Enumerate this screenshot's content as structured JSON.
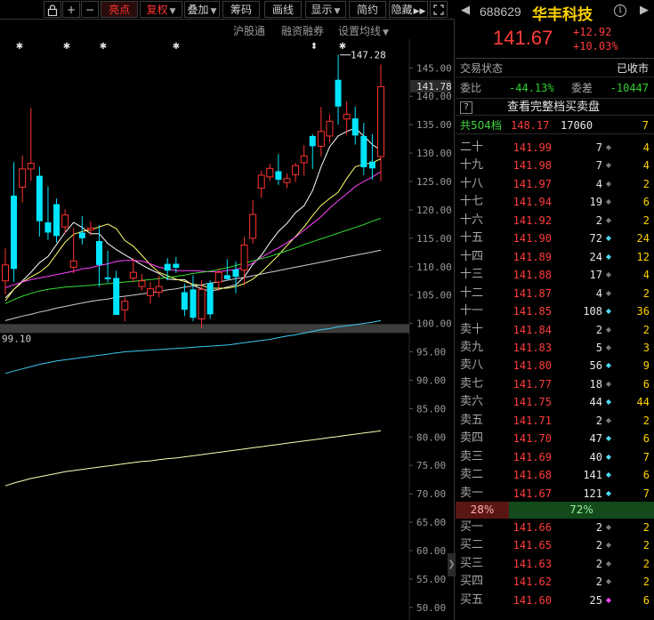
{
  "toolbar": {
    "buttons": [
      {
        "label": "",
        "icon": "lock-icon"
      },
      {
        "label": "+"
      },
      {
        "label": "−"
      },
      {
        "label": "亮点"
      },
      {
        "label": "复权"
      },
      {
        "label": "叠加"
      },
      {
        "label": "筹码"
      },
      {
        "label": "画线"
      },
      {
        "label": "显示"
      },
      {
        "label": "简约"
      },
      {
        "label": "隐藏"
      }
    ],
    "expand_icon": "expand-icon"
  },
  "subbar": {
    "hgt": "沪股通",
    "margin": "融资融券",
    "ma_settings": "设置均线"
  },
  "chart_data": {
    "type": "candlestick",
    "y_axis": {
      "ticks": [
        145.0,
        140.0,
        135.0,
        130.0,
        125.0,
        120.0,
        115.0,
        110.0,
        105.0,
        100.0,
        95.0,
        90.0,
        85.0,
        80.0,
        75.0,
        70.0,
        65.0,
        60.0,
        55.0,
        50.0
      ],
      "tick_labels": [
        "145.00",
        "140.00",
        "135.00",
        "130.00",
        "125.00",
        "120.00",
        "115.00",
        "110.00",
        "105.00",
        "100.00",
        "95.00",
        "90.00",
        "85.00",
        "80.00",
        "75.00",
        "70.00",
        "65.00",
        "60.00",
        "55.00",
        "50.00"
      ],
      "current_label": "141.78",
      "current_value": 141.78,
      "range": [
        49.5,
        152.0
      ]
    },
    "annotations": {
      "high_label": "147.28",
      "high_value": 147.28,
      "low_label": "99.10",
      "low_value": 99.1
    },
    "candles": [
      {
        "o": 107.5,
        "h": 113.2,
        "l": 105.1,
        "c": 110.3
      },
      {
        "o": 122.5,
        "h": 128.4,
        "l": 107.3,
        "c": 109.6
      },
      {
        "o": 124.0,
        "h": 129.6,
        "l": 121.3,
        "c": 127.2
      },
      {
        "o": 127.2,
        "h": 137.9,
        "l": 125.1,
        "c": 128.2
      },
      {
        "o": 126.0,
        "h": 127.6,
        "l": 115.3,
        "c": 118.0
      },
      {
        "o": 117.8,
        "h": 124.1,
        "l": 114.7,
        "c": 116.0
      },
      {
        "o": 121.0,
        "h": 122.0,
        "l": 114.2,
        "c": 115.4
      },
      {
        "o": 117.0,
        "h": 120.1,
        "l": 115.9,
        "c": 119.1
      },
      {
        "o": 109.9,
        "h": 116.9,
        "l": 108.8,
        "c": 111.0
      },
      {
        "o": 116.0,
        "h": 118.9,
        "l": 113.9,
        "c": 115.0
      },
      {
        "o": 116.5,
        "h": 118.0,
        "l": 115.5,
        "c": 116.8
      },
      {
        "o": 114.5,
        "h": 117.3,
        "l": 106.5,
        "c": 110.3
      },
      {
        "o": 108.1,
        "h": 112.8,
        "l": 107.2,
        "c": 107.8
      },
      {
        "o": 108.0,
        "h": 109.3,
        "l": 101.8,
        "c": 101.5
      },
      {
        "o": 102.4,
        "h": 104.6,
        "l": 100.4,
        "c": 103.9
      },
      {
        "o": 108.0,
        "h": 111.5,
        "l": 107.3,
        "c": 109.0
      },
      {
        "o": 106.5,
        "h": 108.7,
        "l": 105.8,
        "c": 107.5
      },
      {
        "o": 104.9,
        "h": 107.3,
        "l": 103.5,
        "c": 106.1
      },
      {
        "o": 105.5,
        "h": 108.4,
        "l": 104.6,
        "c": 106.5
      },
      {
        "o": 110.5,
        "h": 111.5,
        "l": 107.6,
        "c": 109.3
      },
      {
        "o": 110.5,
        "h": 111.7,
        "l": 108.9,
        "c": 109.8
      },
      {
        "o": 105.5,
        "h": 107.0,
        "l": 101.3,
        "c": 102.4
      },
      {
        "o": 106.0,
        "h": 108.5,
        "l": 100.4,
        "c": 101.0
      },
      {
        "o": 100.8,
        "h": 107.6,
        "l": 99.1,
        "c": 106.0
      },
      {
        "o": 107.1,
        "h": 107.6,
        "l": 100.8,
        "c": 101.6
      },
      {
        "o": 107.3,
        "h": 109.7,
        "l": 105.8,
        "c": 109.0
      },
      {
        "o": 108.5,
        "h": 111.3,
        "l": 107.6,
        "c": 107.8
      },
      {
        "o": 109.5,
        "h": 110.9,
        "l": 105.3,
        "c": 108.2
      },
      {
        "o": 109.4,
        "h": 115.2,
        "l": 106.7,
        "c": 113.8
      },
      {
        "o": 115.0,
        "h": 121.7,
        "l": 114.1,
        "c": 119.2
      },
      {
        "o": 123.8,
        "h": 126.9,
        "l": 122.1,
        "c": 126.1
      },
      {
        "o": 125.8,
        "h": 128.1,
        "l": 125.1,
        "c": 127.3
      },
      {
        "o": 126.8,
        "h": 129.8,
        "l": 124.4,
        "c": 125.3
      },
      {
        "o": 124.8,
        "h": 126.4,
        "l": 123.8,
        "c": 125.5
      },
      {
        "o": 126.2,
        "h": 128.3,
        "l": 124.9,
        "c": 127.8
      },
      {
        "o": 128.3,
        "h": 131.4,
        "l": 126.0,
        "c": 129.5
      },
      {
        "o": 133.0,
        "h": 133.3,
        "l": 127.2,
        "c": 131.2
      },
      {
        "o": 131.2,
        "h": 138.1,
        "l": 129.4,
        "c": 133.8
      },
      {
        "o": 133.0,
        "h": 136.8,
        "l": 131.9,
        "c": 135.6
      },
      {
        "o": 142.9,
        "h": 147.3,
        "l": 135.0,
        "c": 138.2
      },
      {
        "o": 136.0,
        "h": 139.1,
        "l": 133.2,
        "c": 136.8
      },
      {
        "o": 136.1,
        "h": 138.2,
        "l": 131.5,
        "c": 133.1
      },
      {
        "o": 133.0,
        "h": 135.3,
        "l": 126.1,
        "c": 127.5
      },
      {
        "o": 128.5,
        "h": 133.3,
        "l": 125.3,
        "c": 127.3
      },
      {
        "o": 129.4,
        "h": 145.6,
        "l": 125.0,
        "c": 141.7
      }
    ],
    "ma_lines": [
      {
        "color": "#ffffff",
        "values": [
          104.5,
          106.0,
          107.5,
          109.0,
          110.7,
          111.8,
          113.9,
          116.0,
          117.8,
          116.9,
          115.8,
          115.8,
          114.1,
          113.0,
          112.1,
          111.2,
          110.3,
          109.5,
          108.8,
          107.8,
          107.7,
          107.7,
          106.7,
          106.1,
          105.7,
          106.0,
          106.4,
          106.8,
          108.2,
          110.4,
          112.0,
          114.2,
          116.2,
          117.6,
          119.5,
          120.7,
          123.4,
          127.6,
          131.1,
          133.0,
          133.8,
          134.4,
          133.0,
          131.5,
          130.5
        ]
      },
      {
        "color": "#ffff66",
        "values": [
          104.0,
          106.0,
          107.3,
          108.2,
          109.0,
          110.2,
          112.2,
          114.3,
          115.7,
          116.2,
          116.5,
          117.0,
          117.5,
          116.7,
          114.6,
          113.6,
          112.0,
          110.3,
          109.0,
          108.4,
          107.8,
          107.4,
          106.9,
          106.7,
          106.2,
          106.2,
          106.2,
          106.5,
          107.0,
          107.8,
          109.0,
          110.5,
          112.0,
          113.7,
          115.3,
          117.0,
          119.0,
          120.8,
          122.0,
          123.1,
          125.5,
          127.6,
          128.0,
          128.3,
          129.0
        ]
      },
      {
        "color": "#ff40ff",
        "values": [
          106.3,
          106.8,
          107.3,
          107.7,
          108.0,
          108.3,
          108.6,
          108.9,
          109.2,
          109.6,
          109.8,
          110.2,
          110.5,
          110.9,
          111.1,
          111.1,
          111.0,
          110.5,
          109.9,
          109.6,
          109.3,
          109.3,
          109.3,
          109.2,
          109.1,
          109.1,
          109.3,
          109.5,
          109.9,
          110.6,
          111.6,
          112.5,
          113.3,
          114.2,
          115.2,
          116.4,
          117.6,
          118.8,
          120.3,
          121.6,
          122.8,
          124.1,
          125.0,
          125.8,
          126.7
        ]
      },
      {
        "color": "#33dd33",
        "values": [
          103.5,
          104.2,
          104.8,
          105.3,
          105.7,
          106.0,
          106.2,
          106.4,
          106.5,
          106.6,
          106.7,
          106.9,
          107.0,
          107.1,
          107.3,
          107.4,
          107.6,
          107.7,
          107.9,
          108.1,
          108.3,
          108.5,
          108.8,
          109.0,
          109.2,
          109.5,
          109.8,
          110.2,
          110.6,
          111.0,
          111.4,
          111.8,
          112.3,
          112.8,
          113.3,
          113.9,
          114.4,
          114.9,
          115.4,
          115.9,
          116.4,
          116.9,
          117.4,
          118.0,
          118.5
        ]
      },
      {
        "color": "#cfcfcf",
        "values": [
          100.5,
          100.9,
          101.3,
          101.6,
          102.0,
          102.3,
          102.7,
          103.0,
          103.3,
          103.6,
          103.9,
          104.1,
          104.3,
          104.6,
          104.8,
          105.0,
          105.2,
          105.4,
          105.6,
          105.9,
          106.1,
          106.4,
          106.6,
          106.8,
          107.1,
          107.3,
          107.6,
          107.9,
          108.1,
          108.4,
          108.7,
          109.0,
          109.3,
          109.6,
          109.9,
          110.2,
          110.5,
          110.8,
          111.1,
          111.4,
          111.7,
          112.0,
          112.3,
          112.6,
          112.9
        ]
      },
      {
        "color": "#3bc8f0",
        "values": [
          91.2,
          91.6,
          92.0,
          92.4,
          92.8,
          93.1,
          93.4,
          93.6,
          93.8,
          94.0,
          94.2,
          94.4,
          94.6,
          94.8,
          95.0,
          95.1,
          95.2,
          95.3,
          95.4,
          95.5,
          95.6,
          95.7,
          95.8,
          95.9,
          96.0,
          96.1,
          96.2,
          96.4,
          96.6,
          96.8,
          97.0,
          97.2,
          97.5,
          97.8,
          98.0,
          98.3,
          98.6,
          98.9,
          99.1,
          99.4,
          99.6,
          99.8,
          100.0,
          100.2,
          100.5
        ]
      },
      {
        "color": "#ffffb0",
        "values": [
          71.4,
          71.9,
          72.3,
          72.7,
          73.0,
          73.3,
          73.6,
          73.9,
          74.1,
          74.3,
          74.5,
          74.7,
          74.9,
          75.1,
          75.3,
          75.5,
          75.7,
          75.8,
          76.0,
          76.2,
          76.3,
          76.5,
          76.7,
          76.9,
          77.1,
          77.3,
          77.5,
          77.7,
          77.9,
          78.1,
          78.3,
          78.5,
          78.7,
          78.9,
          79.1,
          79.3,
          79.5,
          79.7,
          79.9,
          80.1,
          80.3,
          80.5,
          80.7,
          80.9,
          81.1
        ]
      }
    ],
    "markers": {
      "candle_indices": [
        2,
        9,
        14,
        25,
        44
      ],
      "star_indices": [
        1,
        4,
        7,
        12
      ],
      "arrow_index": 43
    }
  },
  "quote": {
    "code": "688629",
    "name": "华丰科技",
    "price": "141.67",
    "change": "+12.92",
    "change_pct": "+10.03%",
    "status_label": "交易状态",
    "status_value": "已收市",
    "weibi_label": "委比",
    "weibi_value": "-44.13%",
    "weicha_label": "委差",
    "weicha_value": "-10447",
    "full_book_q": "?",
    "full_book_label": "查看完整档买卖盘",
    "total": {
      "label": "共504档",
      "price": "148.17",
      "vol": "17060",
      "cnt": "7"
    },
    "asks": [
      {
        "label": "二十",
        "price": "141.99",
        "vol": "7",
        "dot": "grey",
        "cnt": "4"
      },
      {
        "label": "十九",
        "price": "141.98",
        "vol": "7",
        "dot": "grey",
        "cnt": "4"
      },
      {
        "label": "十八",
        "price": "141.97",
        "vol": "4",
        "dot": "grey",
        "cnt": "2"
      },
      {
        "label": "十七",
        "price": "141.94",
        "vol": "19",
        "dot": "grey",
        "cnt": "6"
      },
      {
        "label": "十六",
        "price": "141.92",
        "vol": "2",
        "dot": "grey",
        "cnt": "2"
      },
      {
        "label": "十五",
        "price": "141.90",
        "vol": "72",
        "dot": "cyan",
        "cnt": "24"
      },
      {
        "label": "十四",
        "price": "141.89",
        "vol": "24",
        "dot": "cyan",
        "cnt": "12"
      },
      {
        "label": "十三",
        "price": "141.88",
        "vol": "17",
        "dot": "grey",
        "cnt": "4"
      },
      {
        "label": "十二",
        "price": "141.87",
        "vol": "4",
        "dot": "grey",
        "cnt": "2"
      },
      {
        "label": "十一",
        "price": "141.85",
        "vol": "108",
        "dot": "cyan",
        "cnt": "36"
      },
      {
        "label": "卖十",
        "price": "141.84",
        "vol": "2",
        "dot": "grey",
        "cnt": "2"
      },
      {
        "label": "卖九",
        "price": "141.83",
        "vol": "5",
        "dot": "grey",
        "cnt": "3"
      },
      {
        "label": "卖八",
        "price": "141.80",
        "vol": "56",
        "dot": "cyan",
        "cnt": "9"
      },
      {
        "label": "卖七",
        "price": "141.77",
        "vol": "18",
        "dot": "grey",
        "cnt": "6"
      },
      {
        "label": "卖六",
        "price": "141.75",
        "vol": "44",
        "dot": "cyan",
        "cnt": "44"
      },
      {
        "label": "卖五",
        "price": "141.71",
        "vol": "2",
        "dot": "grey",
        "cnt": "2"
      },
      {
        "label": "卖四",
        "price": "141.70",
        "vol": "47",
        "dot": "cyan",
        "cnt": "6"
      },
      {
        "label": "卖三",
        "price": "141.69",
        "vol": "40",
        "dot": "cyan",
        "cnt": "7"
      },
      {
        "label": "卖二",
        "price": "141.68",
        "vol": "141",
        "dot": "cyan",
        "cnt": "6"
      },
      {
        "label": "卖一",
        "price": "141.67",
        "vol": "121",
        "dot": "cyan",
        "cnt": "7"
      }
    ],
    "ratio": {
      "sell": "28%",
      "buy": "72%"
    },
    "bids": [
      {
        "label": "买一",
        "price": "141.66",
        "vol": "2",
        "dot": "grey",
        "cnt": "2"
      },
      {
        "label": "买二",
        "price": "141.65",
        "vol": "2",
        "dot": "grey",
        "cnt": "2"
      },
      {
        "label": "买三",
        "price": "141.63",
        "vol": "2",
        "dot": "grey",
        "cnt": "2"
      },
      {
        "label": "买四",
        "price": "141.62",
        "vol": "2",
        "dot": "grey",
        "cnt": "2"
      },
      {
        "label": "买五",
        "price": "141.60",
        "vol": "25",
        "dot": "magenta",
        "cnt": "6"
      }
    ]
  }
}
